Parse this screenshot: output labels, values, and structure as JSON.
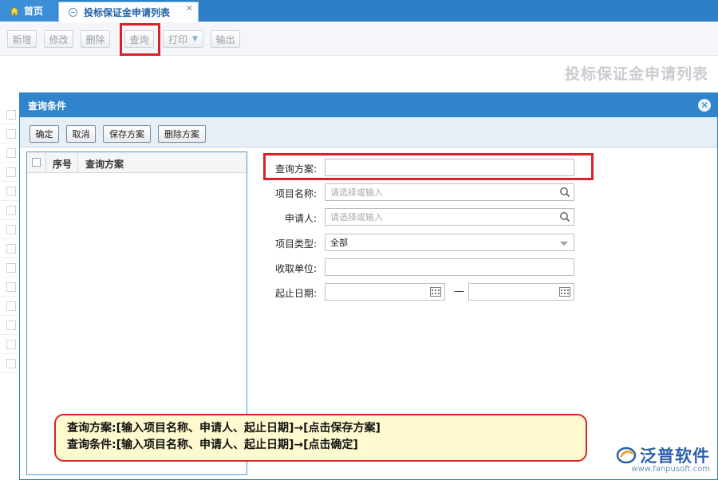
{
  "tabs": {
    "home": "首页",
    "active": "投标保证金申请列表",
    "close": "✕"
  },
  "toolbar": {
    "new": "新增",
    "edit": "修改",
    "delete": "删除",
    "query": "查询",
    "print": "打印",
    "print_arrow": "▼",
    "export": "输出"
  },
  "page_title": "投标保证金申请列表",
  "dialog": {
    "title": "查询条件",
    "close": "✕",
    "buttons": {
      "confirm": "确定",
      "cancel": "取消",
      "save_plan": "保存方案",
      "delete_plan": "删除方案"
    },
    "list": {
      "col_index": "序号",
      "col_plan": "查询方案"
    },
    "form": {
      "plan_label": "查询方案:",
      "plan_value": "",
      "project_label": "项目名称:",
      "project_placeholder": "请选择或输入",
      "applicant_label": "申请人:",
      "applicant_placeholder": "请选择或输入",
      "type_label": "项目类型:",
      "type_value": "全部",
      "unit_label": "收取单位:",
      "unit_value": "",
      "date_label": "起止日期:",
      "date_sep": "—",
      "date_start": "",
      "date_end": ""
    }
  },
  "note": {
    "line1": "查询方案:[输入项目名称、申请人、起止日期]→[点击保存方案]",
    "line2": "查询条件:[输入项目名称、申请人、起止日期]→[点击确定]"
  },
  "logo": {
    "name": "泛普软件",
    "url": "www.fanpusoft.com"
  },
  "colors": {
    "accent": "#2f84cc",
    "highlight": "#d8222a",
    "note_bg": "#fff9cf"
  }
}
